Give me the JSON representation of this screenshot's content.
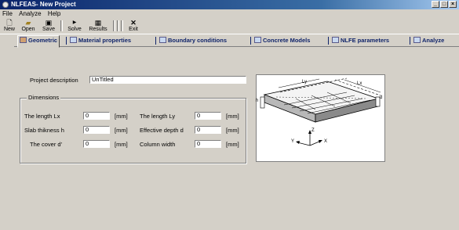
{
  "window": {
    "title": "NLFEAS- New Project"
  },
  "menu": [
    "File",
    "Analyze",
    "Help"
  ],
  "toolbar": {
    "new": "New",
    "open": "Open",
    "save": "Save",
    "solve": "Solve",
    "results": "Results",
    "exit": "Exit"
  },
  "tabs": [
    "Geometric",
    "Material properties",
    "Boundary conditions",
    "Concrete Models",
    "NLFE parameters",
    "Analyze"
  ],
  "form": {
    "project_label": "Project description",
    "project_value": "UnTitled",
    "dimensions_legend": "Dimensions",
    "fields": [
      {
        "label": "The length Lx",
        "value": "0",
        "unit": "[mm]"
      },
      {
        "label": "The length Ly",
        "value": "0",
        "unit": "[mm]"
      },
      {
        "label": "Slab thikness h",
        "value": "0",
        "unit": "[mm]"
      },
      {
        "label": "Effective depth d",
        "value": "0",
        "unit": "[mm]"
      },
      {
        "label": "The cover d'",
        "value": "0",
        "unit": "[mm]"
      },
      {
        "label": "Column width",
        "value": "0",
        "unit": "[mm]"
      }
    ]
  },
  "diagram": {
    "ly": "Ly",
    "lx": "Lx",
    "h": "h",
    "d": "d",
    "x": "X",
    "y": "Y",
    "z": "Z"
  }
}
